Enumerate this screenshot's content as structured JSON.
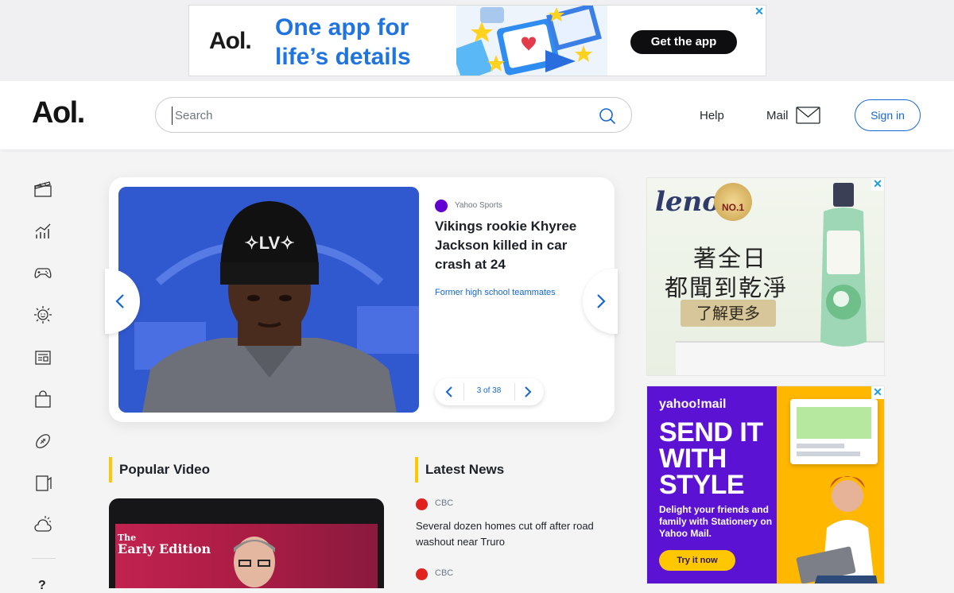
{
  "top_ad": {
    "logo": "Aol.",
    "headline": "One app for life’s details",
    "cta": "Get the app",
    "close": "✕"
  },
  "header": {
    "brand": "Aol.",
    "search_placeholder": "Search",
    "help": "Help",
    "mail": "Mail",
    "sign_in": "Sign in"
  },
  "left_nav": {
    "icons": [
      "entertainment-icon",
      "finance-icon",
      "games-icon",
      "lifestyle-icon",
      "news-icon",
      "shopping-icon",
      "sports-icon",
      "video-icon",
      "weather-icon"
    ],
    "more": "?"
  },
  "hero": {
    "source": "Yahoo Sports",
    "title": "Vikings rookie Khyree Jackson killed in car crash at 24",
    "subtitle": "Former high school teammates",
    "counter": "3 of 38"
  },
  "popular_video": {
    "title": "Popular Video",
    "thumb_line1": "The",
    "thumb_line2": "Early Edition"
  },
  "latest_news": {
    "title": "Latest News",
    "items": [
      {
        "source": "CBC",
        "title": "Several dozen homes cut off after road washout near Truro"
      },
      {
        "source": "CBC",
        "title": ""
      }
    ]
  },
  "ad_lenor": {
    "brand": "lenor",
    "badge": "NO.1",
    "line1": "著全日",
    "line2": "都聞到乾淨",
    "cta": "了解更多",
    "close": "✕"
  },
  "ad_yahoo": {
    "brand": "yahoo!mail",
    "headline": "SEND IT WITH STYLE",
    "sub": "Delight your friends and family with Stationery on Yahoo Mail.",
    "cta": "Try it now",
    "close": "✕"
  },
  "colors": {
    "accent_blue": "#1566d6",
    "section_bar": "#ffc700",
    "yahoo_purple": "#6001d2",
    "cbc_red": "#e0211d"
  }
}
